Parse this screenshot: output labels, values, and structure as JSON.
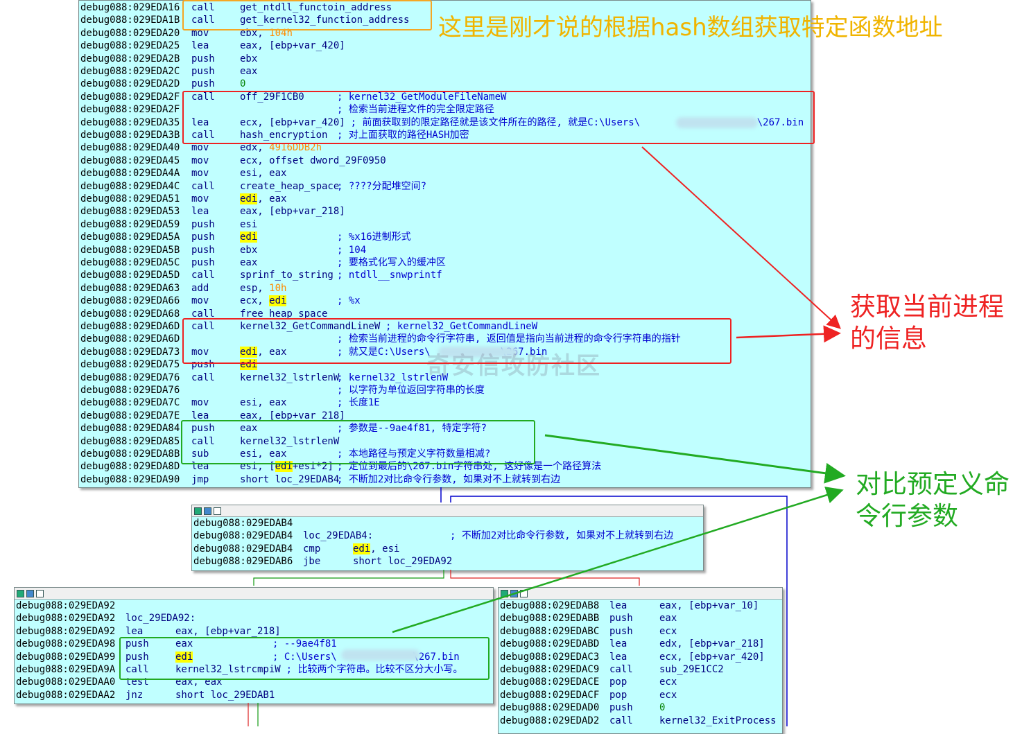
{
  "main_block": {
    "lines": [
      {
        "addr": "debug088:029EDA16",
        "mnem": "call",
        "ops": "get_ntdll_functoin_address",
        "cmt": ""
      },
      {
        "addr": "debug088:029EDA1B",
        "mnem": "call",
        "ops": "get_kernel32_function_address",
        "cmt": ""
      },
      {
        "addr": "debug088:029EDA20",
        "mnem": "mov",
        "ops": "ebx, 104h",
        "cmt": ""
      },
      {
        "addr": "debug088:029EDA25",
        "mnem": "lea",
        "ops": "eax, [ebp+var_420]",
        "cmt": ""
      },
      {
        "addr": "debug088:029EDA2B",
        "mnem": "push",
        "ops": "ebx",
        "cmt": ""
      },
      {
        "addr": "debug088:029EDA2C",
        "mnem": "push",
        "ops": "eax",
        "cmt": ""
      },
      {
        "addr": "debug088:029EDA2D",
        "mnem": "push",
        "ops": "0",
        "cmt": ""
      },
      {
        "addr": "debug088:029EDA2F",
        "mnem": "call",
        "ops": "off_29F1CB0",
        "cmt": "; kernel32_GetModuleFileNameW"
      },
      {
        "addr": "debug088:029EDA2F",
        "mnem": "",
        "ops": "",
        "cmt": "; 检索当前进程文件的完全限定路径"
      },
      {
        "addr": "debug088:029EDA35",
        "mnem": "lea",
        "ops": "ecx, [ebp+var_420]",
        "cmt": "; 前面获取到的限定路径就是该文件所在的路径, 就是C:\\Users\\                    \\267.bin"
      },
      {
        "addr": "debug088:029EDA3B",
        "mnem": "call",
        "ops": "hash_encryption",
        "cmt": "; 对上面获取的路径HASH加密"
      },
      {
        "addr": "debug088:029EDA40",
        "mnem": "mov",
        "ops": "edx, 4916DDB2h",
        "cmt": ""
      },
      {
        "addr": "debug088:029EDA45",
        "mnem": "mov",
        "ops": "ecx, offset dword_29F0950",
        "cmt": ""
      },
      {
        "addr": "debug088:029EDA4A",
        "mnem": "mov",
        "ops": "esi, eax",
        "cmt": ""
      },
      {
        "addr": "debug088:029EDA4C",
        "mnem": "call",
        "ops": "create_heap_space",
        "cmt": "; ????分配堆空间?"
      },
      {
        "addr": "debug088:029EDA51",
        "mnem": "mov",
        "ops": "edi, eax",
        "cmt": ""
      },
      {
        "addr": "debug088:029EDA53",
        "mnem": "lea",
        "ops": "eax, [ebp+var_218]",
        "cmt": ""
      },
      {
        "addr": "debug088:029EDA59",
        "mnem": "push",
        "ops": "esi",
        "cmt": ""
      },
      {
        "addr": "debug088:029EDA5A",
        "mnem": "push",
        "ops": "edi",
        "cmt": "; %x16进制形式"
      },
      {
        "addr": "debug088:029EDA5B",
        "mnem": "push",
        "ops": "ebx",
        "cmt": "; 104"
      },
      {
        "addr": "debug088:029EDA5C",
        "mnem": "push",
        "ops": "eax",
        "cmt": "; 要格式化写入的缓冲区"
      },
      {
        "addr": "debug088:029EDA5D",
        "mnem": "call",
        "ops": "sprinf_to_string",
        "cmt": "; ntdll__snwprintf"
      },
      {
        "addr": "debug088:029EDA63",
        "mnem": "add",
        "ops": "esp, 10h",
        "cmt": ""
      },
      {
        "addr": "debug088:029EDA66",
        "mnem": "mov",
        "ops": "ecx, edi",
        "cmt": "; %x"
      },
      {
        "addr": "debug088:029EDA68",
        "mnem": "call",
        "ops": "free_heap_space",
        "cmt": ""
      },
      {
        "addr": "debug088:029EDA6D",
        "mnem": "call",
        "ops": "kernel32_GetCommandLineW",
        "cmt": "; kernel32_GetCommandLineW"
      },
      {
        "addr": "debug088:029EDA6D",
        "mnem": "",
        "ops": "",
        "cmt": "; 检索当前进程的命令行字符串, 返回值是指向当前进程的命令行字符串的指针"
      },
      {
        "addr": "debug088:029EDA73",
        "mnem": "mov",
        "ops": "edi, eax",
        "cmt": "; 就又是C:\\Users\\            \\267.bin"
      },
      {
        "addr": "debug088:029EDA75",
        "mnem": "push",
        "ops": "edi",
        "cmt": ""
      },
      {
        "addr": "debug088:029EDA76",
        "mnem": "call",
        "ops": "kernel32_lstrlenW",
        "cmt": "; kernel32_lstrlenW"
      },
      {
        "addr": "debug088:029EDA76",
        "mnem": "",
        "ops": "",
        "cmt": "; 以字符为单位返回字符串的长度"
      },
      {
        "addr": "debug088:029EDA7C",
        "mnem": "mov",
        "ops": "esi, eax",
        "cmt": "; 长度1E"
      },
      {
        "addr": "debug088:029EDA7E",
        "mnem": "lea",
        "ops": "eax, [ebp+var_218]",
        "cmt": ""
      },
      {
        "addr": "debug088:029EDA84",
        "mnem": "push",
        "ops": "eax",
        "cmt": "; 参数是--9ae4f81, 特定字符?"
      },
      {
        "addr": "debug088:029EDA85",
        "mnem": "call",
        "ops": "kernel32_lstrlenW",
        "cmt": ""
      },
      {
        "addr": "debug088:029EDA8B",
        "mnem": "sub",
        "ops": "esi, eax",
        "cmt": "; 本地路径与预定义字符数量相减?"
      },
      {
        "addr": "debug088:029EDA8D",
        "mnem": "lea",
        "ops": "esi, [edi+esi*2]",
        "cmt": "; 定位到最后的\\267.bin字符串处, 这好像是一个路径算法"
      },
      {
        "addr": "debug088:029EDA90",
        "mnem": "jmp",
        "ops": "short loc_29EDAB4",
        "cmt": "; 不断加2对比命令行参数, 如果对不上就转到右边"
      }
    ]
  },
  "mid_block": {
    "lines": [
      {
        "addr": "debug088:029EDAB4",
        "mnem": "",
        "ops": "",
        "cmt": ""
      },
      {
        "addr": "debug088:029EDAB4",
        "mnem": "loc_29EDAB4:",
        "ops": "",
        "cmt": "; 不断加2对比命令行参数, 如果对不上就转到右边"
      },
      {
        "addr": "debug088:029EDAB4",
        "mnem": "cmp",
        "ops": "edi, esi",
        "cmt": ""
      },
      {
        "addr": "debug088:029EDAB6",
        "mnem": "jbe",
        "ops": "short loc_29EDA92",
        "cmt": ""
      }
    ]
  },
  "left_block": {
    "lines": [
      {
        "addr": "debug088:029EDA92",
        "mnem": "",
        "ops": "",
        "cmt": ""
      },
      {
        "addr": "debug088:029EDA92",
        "mnem": "loc_29EDA92:",
        "ops": "",
        "cmt": ""
      },
      {
        "addr": "debug088:029EDA92",
        "mnem": "lea",
        "ops": "eax, [ebp+var_218]",
        "cmt": ""
      },
      {
        "addr": "debug088:029EDA98",
        "mnem": "push",
        "ops": "eax",
        "cmt": "; --9ae4f81"
      },
      {
        "addr": "debug088:029EDA99",
        "mnem": "push",
        "ops": "edi",
        "cmt": "; C:\\Users\\             \\267.bin"
      },
      {
        "addr": "debug088:029EDA9A",
        "mnem": "call",
        "ops": "kernel32_lstrcmpiW",
        "cmt": "; 比较两个字符串。比较不区分大小写。"
      },
      {
        "addr": "debug088:029EDAA0",
        "mnem": "test",
        "ops": "eax, eax",
        "cmt": ""
      },
      {
        "addr": "debug088:029EDAA2",
        "mnem": "jnz",
        "ops": "short loc_29EDAB1",
        "cmt": ""
      }
    ]
  },
  "right_block": {
    "lines": [
      {
        "addr": "debug088:029EDAB8",
        "mnem": "lea",
        "ops": "eax, [ebp+var_10]",
        "cmt": ""
      },
      {
        "addr": "debug088:029EDABB",
        "mnem": "push",
        "ops": "eax",
        "cmt": ""
      },
      {
        "addr": "debug088:029EDABC",
        "mnem": "push",
        "ops": "ecx",
        "cmt": ""
      },
      {
        "addr": "debug088:029EDABD",
        "mnem": "lea",
        "ops": "edx, [ebp+var_218]",
        "cmt": ""
      },
      {
        "addr": "debug088:029EDAC3",
        "mnem": "lea",
        "ops": "ecx, [ebp+var_420]",
        "cmt": ""
      },
      {
        "addr": "debug088:029EDAC9",
        "mnem": "call",
        "ops": "sub_29E1CC2",
        "cmt": ""
      },
      {
        "addr": "debug088:029EDACE",
        "mnem": "pop",
        "ops": "ecx",
        "cmt": ""
      },
      {
        "addr": "debug088:029EDACF",
        "mnem": "pop",
        "ops": "ecx",
        "cmt": ""
      },
      {
        "addr": "debug088:029EDAD0",
        "mnem": "push",
        "ops": "0",
        "cmt": ""
      },
      {
        "addr": "debug088:029EDAD2",
        "mnem": "call",
        "ops": "kernel32_ExitProcess",
        "cmt": ""
      }
    ]
  },
  "annotations": {
    "top_note": "这里是刚才说的根据hash数组获取特定函数地址",
    "right_note_1": "获取当前进程\n的信息",
    "right_note_2": "对比预定义命\n令行参数",
    "watermark": "奇安信攻防社区"
  },
  "colors": {
    "block_bg": "#c0ffff",
    "annot_orange": "#f5a623",
    "annot_red": "#ee2222",
    "annot_green": "#22aa22",
    "note_yellow": "#f0b400"
  }
}
